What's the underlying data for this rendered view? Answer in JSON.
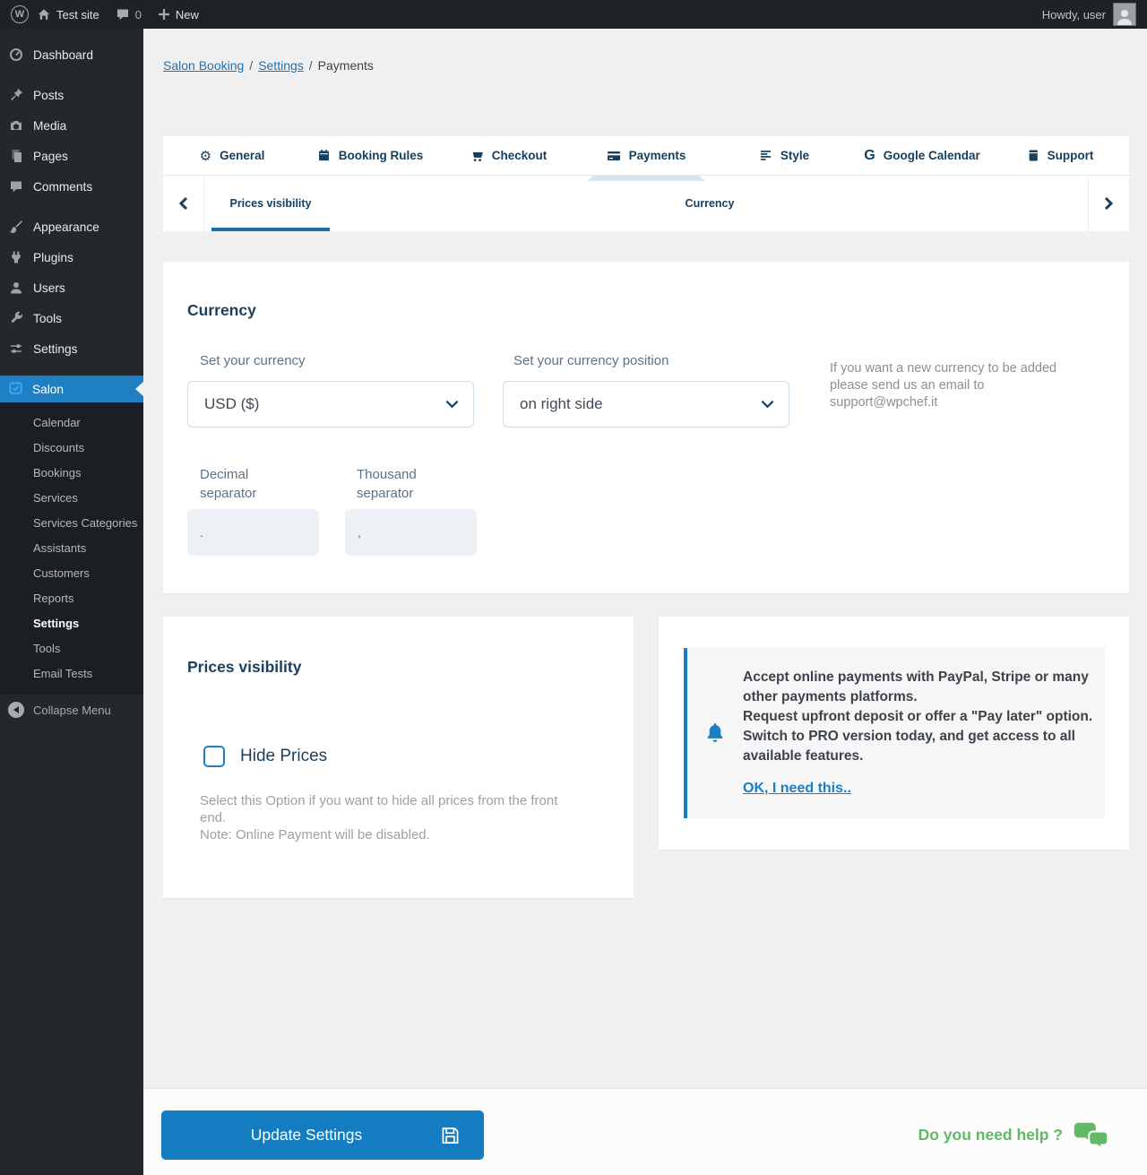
{
  "admin_bar": {
    "wp_logo_letter": "W",
    "site_name": "Test site",
    "comments_count": "0",
    "new_label": "New",
    "howdy": "Howdy, user"
  },
  "sidebar": {
    "items": [
      {
        "label": "Dashboard",
        "icon": "gauge-icon"
      },
      {
        "label": "Posts",
        "icon": "pin-icon"
      },
      {
        "label": "Media",
        "icon": "camera-icon"
      },
      {
        "label": "Pages",
        "icon": "pages-icon"
      },
      {
        "label": "Comments",
        "icon": "comment-icon"
      },
      {
        "label": "Appearance",
        "icon": "brush-icon"
      },
      {
        "label": "Plugins",
        "icon": "plug-icon"
      },
      {
        "label": "Users",
        "icon": "person-icon"
      },
      {
        "label": "Tools",
        "icon": "wrench-icon"
      },
      {
        "label": "Settings",
        "icon": "sliders-icon"
      }
    ],
    "salon": {
      "label": "Salon",
      "icon": "calendar-check-icon"
    },
    "salon_submenu": [
      "Calendar",
      "Discounts",
      "Bookings",
      "Services",
      "Services Categories",
      "Assistants",
      "Customers",
      "Reports",
      "Settings",
      "Tools",
      "Email Tests"
    ],
    "current_submenu_item": "Settings",
    "collapse_label": "Collapse Menu"
  },
  "breadcrumb": {
    "separator": "/",
    "items": [
      {
        "label": "Salon Booking",
        "link": true
      },
      {
        "label": "Settings",
        "link": true
      },
      {
        "label": "Payments",
        "link": false
      }
    ]
  },
  "tabs": [
    {
      "label": "General",
      "icon": "gear-icon"
    },
    {
      "label": "Booking Rules",
      "icon": "calendar-icon"
    },
    {
      "label": "Checkout",
      "icon": "cart-icon"
    },
    {
      "label": "Payments",
      "icon": "credit-card-icon",
      "active": true
    },
    {
      "label": "Style",
      "icon": "align-bars-icon"
    },
    {
      "label": "Google Calendar",
      "icon": "google-g-icon",
      "icon_letter": "G"
    },
    {
      "label": "Support",
      "icon": "book-icon"
    }
  ],
  "subtabs": {
    "items": [
      "Prices visibility",
      "Currency"
    ],
    "active": "Prices visibility"
  },
  "currency_section": {
    "title": "Currency",
    "currency_label": "Set your currency",
    "currency_value": "USD ($)",
    "position_label": "Set your currency position",
    "position_value": "on right side",
    "help_text": "If you want a new currency to be added please send us an email to support@wpchef.it",
    "decimal_label": "Decimal separator",
    "decimal_value": ".",
    "thousand_label": "Thousand separator",
    "thousand_value": ","
  },
  "prices_section": {
    "title": "Prices visibility",
    "checkbox_label": "Hide Prices",
    "checkbox_checked": false,
    "help_line1": "Select this Option if you want to hide all prices from the front end.",
    "help_line2": "Note: Online Payment will be disabled."
  },
  "promo": {
    "line1": "Accept online payments with PayPal, Stripe or many other payments platforms.",
    "line2": "Request upfront deposit or offer a \"Pay later\" option.",
    "line3": "Switch to PRO version today, and get access to all available features.",
    "link_label": "OK, I need this.."
  },
  "footer": {
    "update_button_label": "Update Settings",
    "help_label": "Do you need help ?"
  },
  "colors": {
    "accent_blue": "#1a7fc4",
    "active_menu_blue": "#1e7fc2",
    "heading_navy": "#1c3f5e",
    "help_green": "#62b965",
    "admin_bar_bg": "#1d2327",
    "sidebar_bg": "#23282d"
  }
}
